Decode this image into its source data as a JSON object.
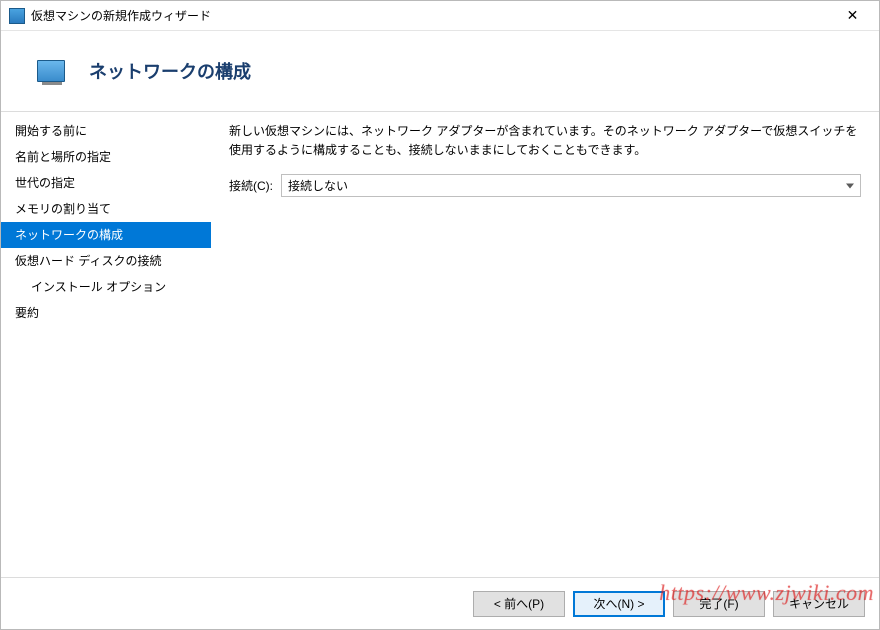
{
  "window": {
    "title": "仮想マシンの新規作成ウィザード"
  },
  "header": {
    "heading": "ネットワークの構成"
  },
  "sidebar": {
    "items": [
      {
        "label": "開始する前に",
        "selected": false,
        "indent": false
      },
      {
        "label": "名前と場所の指定",
        "selected": false,
        "indent": false
      },
      {
        "label": "世代の指定",
        "selected": false,
        "indent": false
      },
      {
        "label": "メモリの割り当て",
        "selected": false,
        "indent": false
      },
      {
        "label": "ネットワークの構成",
        "selected": true,
        "indent": false
      },
      {
        "label": "仮想ハード ディスクの接続",
        "selected": false,
        "indent": false
      },
      {
        "label": "インストール オプション",
        "selected": false,
        "indent": true
      },
      {
        "label": "要約",
        "selected": false,
        "indent": false
      }
    ]
  },
  "content": {
    "description": "新しい仮想マシンには、ネットワーク アダプターが含まれています。そのネットワーク アダプターで仮想スイッチを使用するように構成することも、接続しないままにしておくこともできます。",
    "connection_label": "接続(C):",
    "connection_value": "接続しない"
  },
  "footer": {
    "previous": "< 前へ(P)",
    "next": "次へ(N) >",
    "finish": "完了(F)",
    "cancel": "キャンセル"
  },
  "watermark": "https://www.zjwiki.com"
}
